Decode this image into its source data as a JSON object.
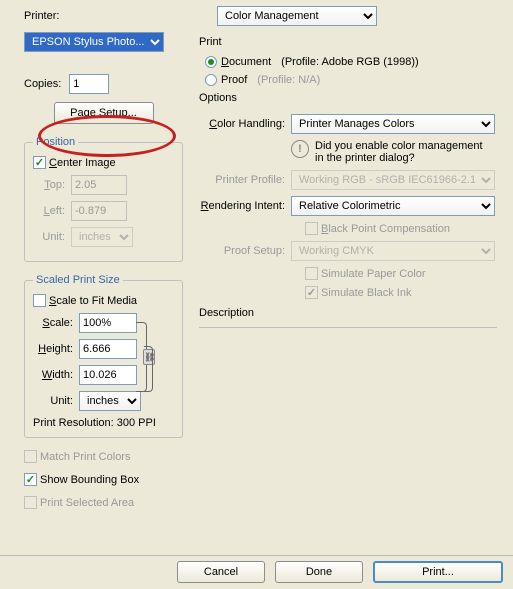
{
  "left": {
    "printer_label": "Printer:",
    "printer_value": "EPSON Stylus Photo...",
    "copies_label": "Copies:",
    "copies_value": "1",
    "page_setup": "Page Setup...",
    "position": {
      "legend": "Position",
      "center_image": "Center Image",
      "top_label": "Top:",
      "top_value": "2.05",
      "left_label": "Left:",
      "left_value": "-0.879",
      "unit_label": "Unit:",
      "unit_value": "inches"
    },
    "scaled": {
      "legend": "Scaled Print Size",
      "scale_to_fit": "Scale to Fit Media",
      "scale_label": "Scale:",
      "scale_value": "100%",
      "height_label": "Height:",
      "height_value": "6.666",
      "width_label": "Width:",
      "width_value": "10.026",
      "unit_label": "Unit:",
      "unit_value": "inches",
      "resolution": "Print Resolution: 300 PPI"
    },
    "match_print_colors": "Match Print Colors",
    "show_bbox": "Show Bounding Box",
    "print_selected": "Print Selected Area"
  },
  "right": {
    "dropdown_value": "Color Management",
    "print_label": "Print",
    "document_label": "Document",
    "document_profile": "(Profile: Adobe RGB (1998))",
    "proof_label": "Proof",
    "proof_profile": "(Profile: N/A)",
    "options_label": "Options",
    "color_handling_label": "Color Handling:",
    "color_handling_value": "Printer Manages Colors",
    "info_text_1": "Did you enable color management",
    "info_text_2": "in the printer dialog?",
    "printer_profile_label": "Printer Profile:",
    "printer_profile_value": "Working RGB - sRGB IEC61966-2.1",
    "rendering_intent_label": "Rendering Intent:",
    "rendering_intent_value": "Relative Colorimetric",
    "bpc_label": "Black Point Compensation",
    "proof_setup_label": "Proof Setup:",
    "proof_setup_value": "Working CMYK",
    "sim_paper_label": "Simulate Paper Color",
    "sim_black_label": "Simulate Black Ink",
    "description_label": "Description"
  },
  "buttons": {
    "cancel": "Cancel",
    "done": "Done",
    "print": "Print..."
  }
}
